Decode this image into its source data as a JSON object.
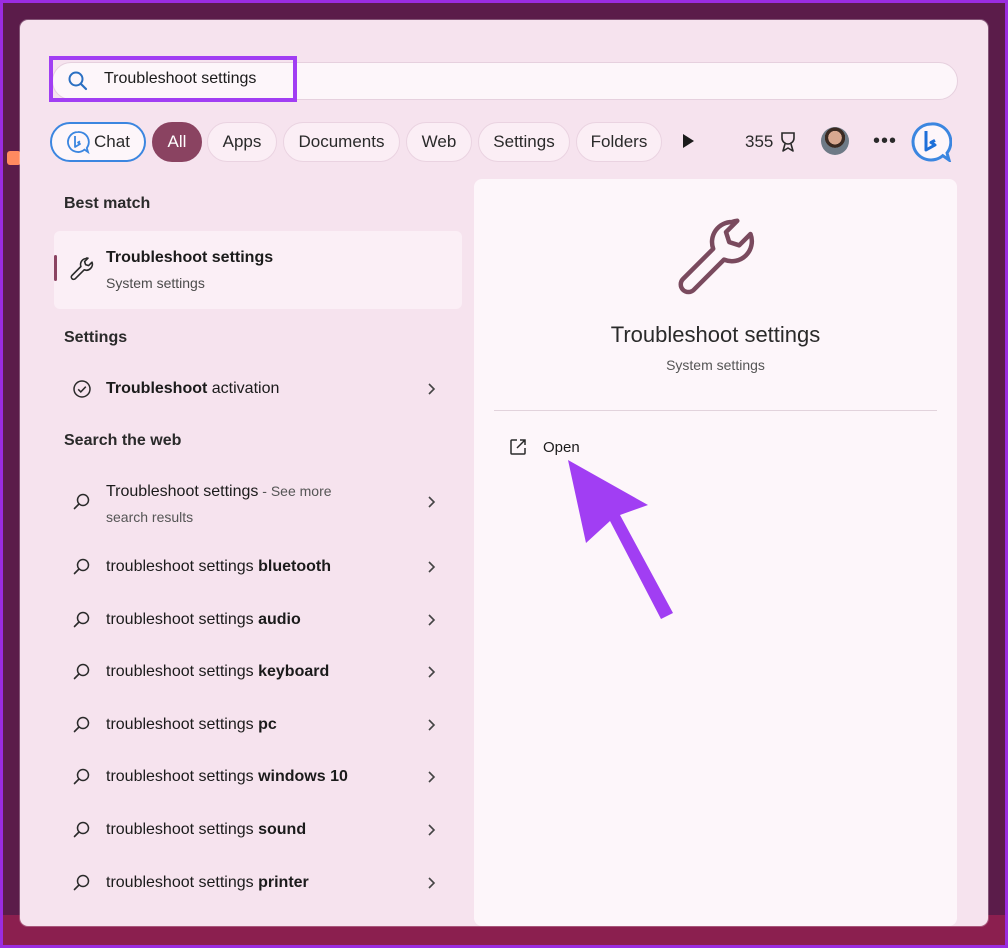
{
  "search": {
    "query": "Troubleshoot settings"
  },
  "filters": {
    "chat": "Chat",
    "all": "All",
    "apps": "Apps",
    "documents": "Documents",
    "web": "Web",
    "settings": "Settings",
    "folders": "Folders"
  },
  "header": {
    "points": "355"
  },
  "left": {
    "best_match_title": "Best match",
    "best_match": {
      "title": "Troubleshoot settings",
      "subtitle": "System settings"
    },
    "settings_title": "Settings",
    "settings_item": {
      "bold": "Troubleshoot",
      "rest": " activation"
    },
    "web_title": "Search the web",
    "web_first": {
      "title": "Troubleshoot settings",
      "see_more": " - See more",
      "sub": "search results"
    },
    "web_items": [
      {
        "prefix": "troubleshoot settings ",
        "bold": "bluetooth"
      },
      {
        "prefix": "troubleshoot settings ",
        "bold": "audio"
      },
      {
        "prefix": "troubleshoot settings ",
        "bold": "keyboard"
      },
      {
        "prefix": "troubleshoot settings ",
        "bold": "pc"
      },
      {
        "prefix": "troubleshoot settings ",
        "bold": "windows 10"
      },
      {
        "prefix": "troubleshoot settings ",
        "bold": "sound"
      },
      {
        "prefix": "troubleshoot settings ",
        "bold": "printer"
      }
    ]
  },
  "detail": {
    "title": "Troubleshoot settings",
    "subtitle": "System settings",
    "open_label": "Open"
  },
  "colors": {
    "accent": "#8a4361",
    "highlight": "#a13ef3",
    "bing_blue": "#3b86e0"
  },
  "icons": {
    "search": "search-icon",
    "wrench": "wrench-icon",
    "check": "check-circle-icon",
    "chevron": "chevron-right-icon",
    "open": "open-external-icon",
    "bing": "bing-icon"
  }
}
